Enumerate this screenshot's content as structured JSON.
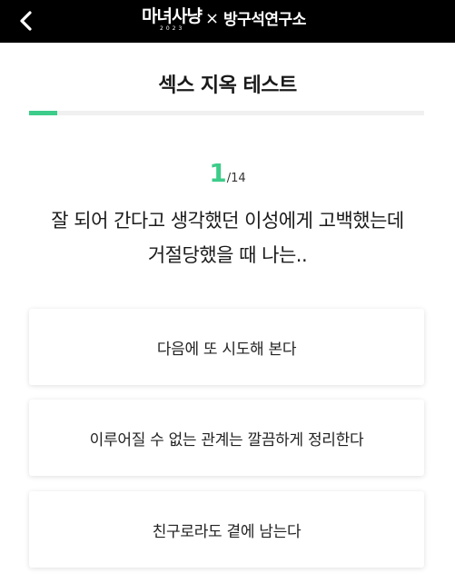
{
  "header": {
    "back_icon": "chevron-left-icon",
    "brand_primary": "마녀사냥",
    "brand_primary_year": "2023",
    "brand_separator": "×",
    "brand_secondary": "방구석연구소"
  },
  "quiz": {
    "title": "섹스 지옥 테스트",
    "progress": {
      "current": 1,
      "total": 14,
      "fraction": 0.071
    },
    "counter_current": "1",
    "counter_total": "/14",
    "question_line1": "잘 되어 간다고 생각했던 이성에게 고백했는데",
    "question_line2": "거절당했을 때 나는..",
    "answers": [
      {
        "label": "다음에 또 시도해 본다"
      },
      {
        "label": "이루어질 수 없는 관계는 깔끔하게 정리한다"
      },
      {
        "label": "친구로라도 곁에 남는다"
      }
    ]
  },
  "colors": {
    "header_bg": "#000000",
    "accent": "#3dcc8a",
    "track": "#f0f0f0"
  }
}
